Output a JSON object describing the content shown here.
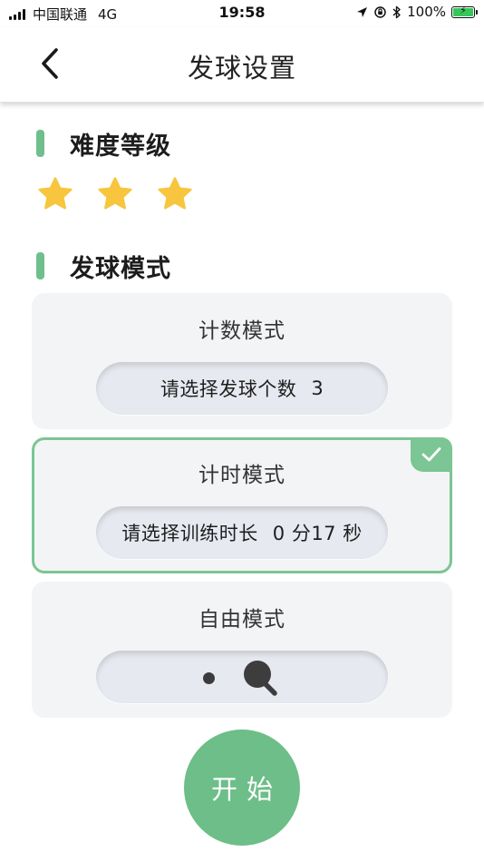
{
  "status_bar": {
    "carrier": "中国联通",
    "network": "4G",
    "time": "19:58",
    "battery": "100%"
  },
  "header": {
    "title": "发球设置",
    "back_icon": "chevron-left-icon"
  },
  "difficulty": {
    "title": "难度等级",
    "stars": 3,
    "max_stars": 3,
    "star_color": "#f7c63e"
  },
  "serve_mode": {
    "title": "发球模式",
    "cards": [
      {
        "title": "计数模式",
        "pill_label": "请选择发球个数",
        "pill_value": "3",
        "selected": false
      },
      {
        "title": "计时模式",
        "pill_label": "请选择训练时长",
        "pill_value": "0 分17 秒",
        "selected": true
      },
      {
        "title": "自由模式",
        "pill_icon": "ping-pong-paddle-icon",
        "selected": false
      }
    ]
  },
  "start_button": {
    "label": "开始"
  },
  "colors": {
    "accent": "#6dbe88",
    "section_bar": "#6fbf8c",
    "card_bg": "#f3f4f6",
    "pill_bg": "#e7e9f1"
  }
}
